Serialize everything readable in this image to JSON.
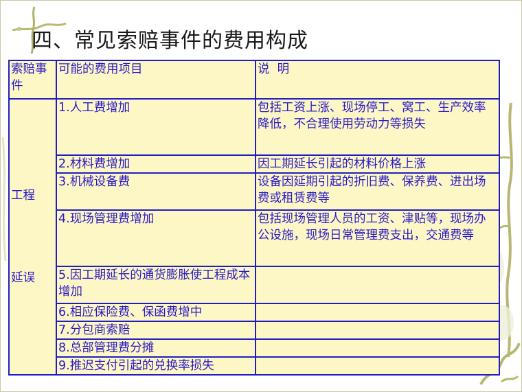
{
  "title": "四、常见索赔事件的费用构成",
  "table": {
    "headers": [
      "索赔事件",
      "可能的费用项目",
      "说  明"
    ],
    "event_lines": [
      "工程",
      "延误"
    ],
    "rows": [
      {
        "item": "1.人工费增加",
        "note": "包括工资上涨、现场停工、窝工、生产效率降低，不合理使用劳动力等损失"
      },
      {
        "item": "2.材料费增加",
        "note": "因工期延长引起的材料价格上涨"
      },
      {
        "item": "3.机械设备费",
        "note": "设备因延期引起的折旧费、保养费、进出场费或租赁费等"
      },
      {
        "item": "4.现场管理费增加",
        "note": "包括现场管理人员的工资、津贴等，现场办公设施，现场日常管理费支出，交通费等"
      },
      {
        "item": "5.因工期延长的通货膨胀使工程成本增加",
        "note": ""
      },
      {
        "item": "6.相应保险费、保函费增中",
        "note": ""
      },
      {
        "item": "7.分包商索赔",
        "note": ""
      },
      {
        "item": "8.总部管理费分摊",
        "note": ""
      },
      {
        "item": "9.推迟支付引起的兑换率损失",
        "note": ""
      }
    ]
  }
}
